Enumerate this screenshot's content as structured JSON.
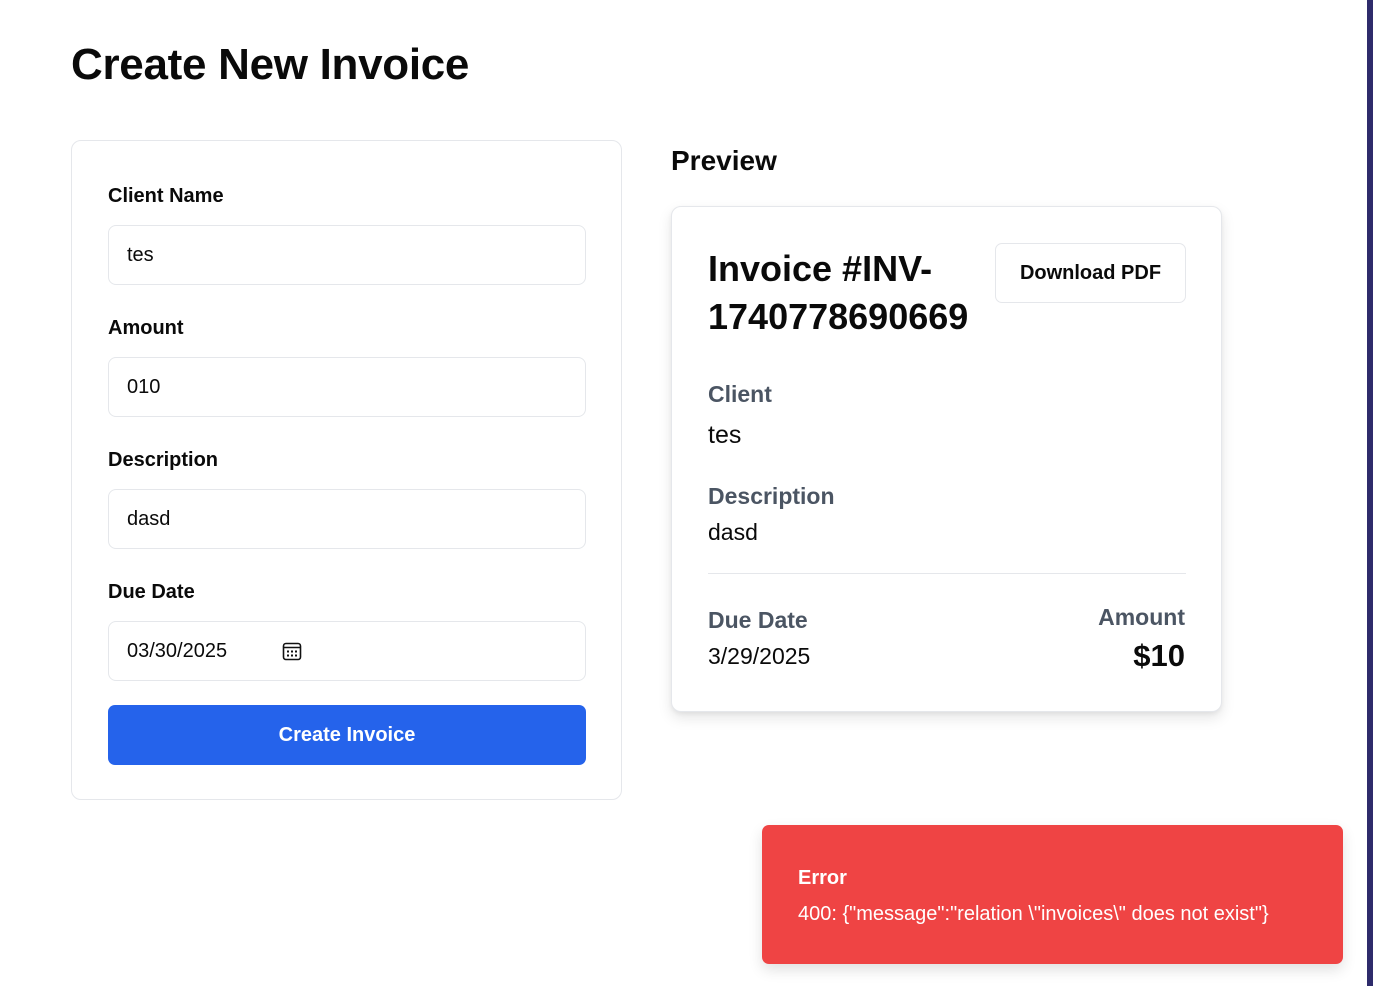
{
  "page": {
    "title": "Create New Invoice"
  },
  "form": {
    "client_name": {
      "label": "Client Name",
      "value": "tes"
    },
    "amount": {
      "label": "Amount",
      "value": "010"
    },
    "description": {
      "label": "Description",
      "value": "dasd"
    },
    "due_date": {
      "label": "Due Date",
      "value": "03/30/2025",
      "icon": "calendar-icon"
    },
    "submit_label": "Create Invoice",
    "colors": {
      "primary": "#2563eb",
      "border": "#e5e7eb"
    }
  },
  "preview": {
    "heading": "Preview",
    "invoice_number": "Invoice #INV-1740778690669",
    "download_label": "Download PDF",
    "client_label": "Client",
    "client_value": "tes",
    "description_label": "Description",
    "description_value": "dasd",
    "due_date_label": "Due Date",
    "due_date_value": "3/29/2025",
    "amount_label": "Amount",
    "amount_value": "$10"
  },
  "toast": {
    "title": "Error",
    "message": "400: {\"message\":\"relation \\\"invoices\\\" does not exist\"}",
    "color": "#ef4444"
  }
}
